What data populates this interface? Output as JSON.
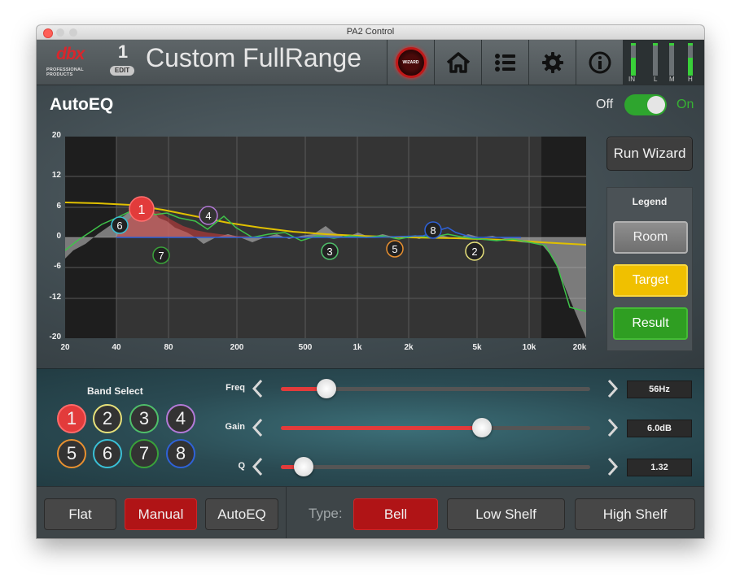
{
  "window": {
    "title": "PA2 Control"
  },
  "header": {
    "logo_text": "dbx",
    "logo_sub": "PROFESSIONAL PRODUCTS",
    "preset_number": "1",
    "edit_label": "EDIT",
    "preset_name": "Custom FullRange",
    "wizard_icon_label": "WIZARD",
    "icons": [
      "wizard-icon",
      "home-icon",
      "list-icon",
      "gear-icon",
      "info-icon"
    ],
    "meters": [
      {
        "label": "IN",
        "level": 0.55
      },
      {
        "label": "L",
        "level": 0.0
      },
      {
        "label": "M",
        "level": 0.0
      },
      {
        "label": "H",
        "level": 0.55
      }
    ]
  },
  "autoeq": {
    "title": "AutoEQ",
    "toggle_off": "Off",
    "toggle_on": "On",
    "enabled": true
  },
  "graph": {
    "y_ticks": [
      "20",
      "12",
      "6",
      "0",
      "-6",
      "-12",
      "-20"
    ],
    "x_ticks": [
      "20",
      "40",
      "80",
      "200",
      "500",
      "1k",
      "2k",
      "5k",
      "10k",
      "20k"
    ],
    "bands": [
      {
        "num": "1",
        "freq": 56,
        "gain": 6.0
      },
      {
        "num": "2",
        "freq": 5000,
        "gain": -2
      },
      {
        "num": "3",
        "freq": 700,
        "gain": -2
      },
      {
        "num": "4",
        "freq": 130,
        "gain": 4.5
      },
      {
        "num": "5",
        "freq": 1700,
        "gain": -1.5
      },
      {
        "num": "6",
        "freq": 40,
        "gain": 2.5
      },
      {
        "num": "7",
        "freq": 75,
        "gain": -3
      },
      {
        "num": "8",
        "freq": 3000,
        "gain": 2
      }
    ]
  },
  "sidebar": {
    "run_wizard": "Run Wizard",
    "legend_title": "Legend",
    "legend_room": "Room",
    "legend_target": "Target",
    "legend_result": "Result"
  },
  "band_select": {
    "title": "Band Select",
    "bands": [
      {
        "label": "1",
        "color": "#e23b3b",
        "active": true
      },
      {
        "label": "2",
        "color": "#e6e07a",
        "active": false
      },
      {
        "label": "3",
        "color": "#4fbf6a",
        "active": false
      },
      {
        "label": "4",
        "color": "#b47ad8",
        "active": false
      },
      {
        "label": "5",
        "color": "#e89030",
        "active": false
      },
      {
        "label": "6",
        "color": "#3ac0d6",
        "active": false
      },
      {
        "label": "7",
        "color": "#3aa23a",
        "active": false
      },
      {
        "label": "8",
        "color": "#2f62d8",
        "active": false
      }
    ]
  },
  "sliders": {
    "freq": {
      "label": "Freq",
      "value": "56Hz",
      "position": 0.15
    },
    "gain": {
      "label": "Gain",
      "value": "6.0dB",
      "position": 0.65
    },
    "q": {
      "label": "Q",
      "value": "1.32",
      "position": 0.07
    }
  },
  "footer": {
    "modes": [
      "Flat",
      "Manual",
      "AutoEQ"
    ],
    "active_mode": "Manual",
    "type_label": "Type:",
    "types": [
      "Bell",
      "Low Shelf",
      "High Shelf"
    ],
    "active_type": "Bell"
  },
  "colors": {
    "accent_red": "#b01416",
    "on_green": "#2ea52e",
    "target_yellow": "#f0c000",
    "result_green": "#2f9e22"
  }
}
